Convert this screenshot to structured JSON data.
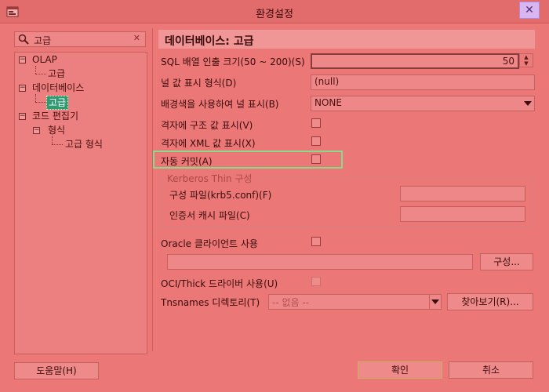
{
  "window": {
    "title": "환경설정",
    "close_symbol": "✕"
  },
  "search": {
    "value": "고급",
    "clear_symbol": "✕"
  },
  "tree": {
    "olap": "OLAP",
    "olap_advanced": "고급",
    "database": "데이터베이스",
    "database_advanced": "고급",
    "code_editor": "코드 편집기",
    "format": "형식",
    "advanced_format": "고급 형식",
    "collapse_symbol": "−"
  },
  "panel": {
    "title": "데이터베이스: 고급",
    "sql_fetch_label": "SQL 배열 인출 크기(50 ~ 200)(S)",
    "sql_fetch_value": "50",
    "null_display_label": "널 값 표시 형식(D)",
    "null_display_value": "(null)",
    "bg_null_label": "배경색을 사용하여 널 표시(B)",
    "bg_null_value": "NONE",
    "grid_struct_label": "격자에 구조 값 표시(V)",
    "grid_xml_label": "격자에 XML 값 표시(X)",
    "autocommit_label": "자동 커밋(A)",
    "kerberos_group": "Kerberos Thin 구성",
    "config_file_label": "구성 파일(krb5.conf)(F)",
    "cred_cache_label": "인증서 캐시 파일(C)",
    "oracle_client_label": "Oracle 클라이언트 사용",
    "configure_button": "구성...",
    "oci_label": "OCI/Thick 드라이버 사용(U)",
    "tnsnames_label": "Tnsnames 디렉토리(T)",
    "tnsnames_value": "-- 없음 --",
    "browse_button": "찾아보기(R)..."
  },
  "footer": {
    "help_button": "도움말(H)",
    "ok_button": "확인",
    "cancel_button": "취소"
  },
  "colors": {
    "background": "#eb7777",
    "selection": "#2f9a72",
    "focus_highlight": "#8ad88a",
    "close_button": "#d8b7f0"
  },
  "icons": {
    "app": "preferences-app-icon",
    "search": "magnifier-icon",
    "clear": "clear-icon",
    "close": "close-icon",
    "dropdown": "chevron-down-icon",
    "spin_up": "spin-up-icon",
    "spin_down": "spin-down-icon"
  }
}
